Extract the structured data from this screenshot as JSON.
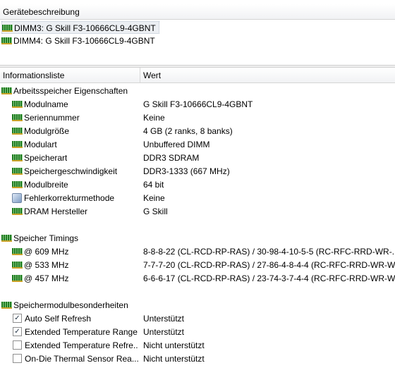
{
  "top": {
    "header": "Gerätebeschreibung",
    "devices": [
      {
        "label": "DIMM3: G Skill F3-10666CL9-4GBNT"
      },
      {
        "label": "DIMM4: G Skill F3-10666CL9-4GBNT"
      }
    ]
  },
  "list": {
    "col1": "Informationsliste",
    "col2": "Wert",
    "groups": [
      {
        "title": "Arbeitsspeicher Eigenschaften",
        "rows": [
          {
            "name": "Modulname",
            "value": "G Skill F3-10666CL9-4GBNT"
          },
          {
            "name": "Seriennummer",
            "value": "Keine"
          },
          {
            "name": "Modulgröße",
            "value": "4 GB (2 ranks, 8 banks)"
          },
          {
            "name": "Modulart",
            "value": "Unbuffered DIMM"
          },
          {
            "name": "Speicherart",
            "value": "DDR3 SDRAM"
          },
          {
            "name": "Speichergeschwindigkeit",
            "value": "DDR3-1333 (667 MHz)"
          },
          {
            "name": "Modulbreite",
            "value": "64 bit"
          },
          {
            "name": "Fehlerkorrekturmethode",
            "value": "Keine"
          },
          {
            "name": "DRAM Hersteller",
            "value": "G Skill"
          }
        ]
      },
      {
        "title": "Speicher Timings",
        "rows": [
          {
            "name": "@ 609 MHz",
            "value": "8-8-8-22  (CL-RCD-RP-RAS) / 30-98-4-10-5-5  (RC-RFC-RRD-WR-..."
          },
          {
            "name": "@ 533 MHz",
            "value": "7-7-7-20  (CL-RCD-RP-RAS) / 27-86-4-8-4-4  (RC-RFC-RRD-WR-W..."
          },
          {
            "name": "@ 457 MHz",
            "value": "6-6-6-17  (CL-RCD-RP-RAS) / 23-74-3-7-4-4  (RC-RFC-RRD-WR-W..."
          }
        ]
      },
      {
        "title": "Speichermodulbesonderheiten",
        "rows": [
          {
            "name": "Auto Self Refresh",
            "value": "Unterstützt",
            "checked": "✓"
          },
          {
            "name": "Extended Temperature Range",
            "value": "Unterstützt",
            "checked": "✓"
          },
          {
            "name": "Extended Temperature Refre...",
            "value": "Nicht unterstützt",
            "checked": ""
          },
          {
            "name": "On-Die Thermal Sensor Rea...",
            "value": "Nicht unterstützt",
            "checked": ""
          }
        ]
      }
    ]
  }
}
